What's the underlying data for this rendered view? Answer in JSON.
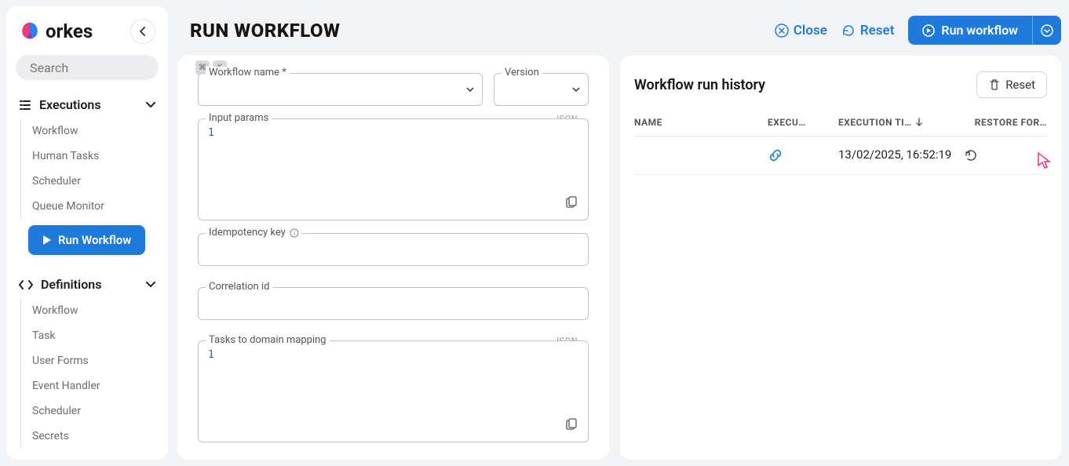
{
  "brand": "orkes",
  "search": {
    "placeholder": "Search"
  },
  "sidebar": {
    "sections": [
      {
        "label": "Executions",
        "items": [
          "Workflow",
          "Human Tasks",
          "Scheduler",
          "Queue Monitor"
        ]
      },
      {
        "label": "Definitions",
        "items": [
          "Workflow",
          "Task",
          "User Forms",
          "Event Handler",
          "Scheduler",
          "Secrets"
        ]
      }
    ],
    "runWorkflow": "Run Workflow"
  },
  "header": {
    "title": "RUN WORKFLOW",
    "close": "Close",
    "reset": "Reset",
    "run": "Run workflow"
  },
  "form": {
    "workflowName": {
      "label": "Workflow name *"
    },
    "version": {
      "label": "Version"
    },
    "inputParams": {
      "label": "Input params",
      "badge": "JSON",
      "code": "1"
    },
    "idempotency": {
      "label": "Idempotency key"
    },
    "correlation": {
      "label": "Correlation id"
    },
    "tasksDomain": {
      "label": "Tasks to domain mapping",
      "badge": "JSON",
      "code": "1"
    }
  },
  "history": {
    "title": "Workflow run history",
    "reset": "Reset",
    "columns": {
      "name": "NAME",
      "exec": "EXECU…",
      "time": "EXECUTION TI…",
      "restore": "RESTORE FOR…"
    },
    "rows": [
      {
        "name": "",
        "execLink": true,
        "time": "13/02/2025, 16:52:19"
      }
    ]
  }
}
